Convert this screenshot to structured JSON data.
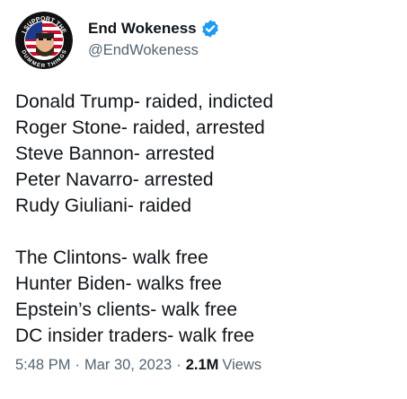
{
  "author": {
    "display_name": "End Wokeness",
    "handle": "@EndWokeness",
    "avatar_text_top": "I SUPPORT THE",
    "avatar_text_bottom": "DUMMER THINGS"
  },
  "tweet": {
    "lines": [
      "Donald Trump- raided, indicted",
      "Roger Stone- raided, arrested",
      "Steve Bannon- arrested",
      "Peter Navarro- arrested",
      "Rudy Giuliani- raided",
      "",
      "The Clintons- walk free",
      "Hunter Biden- walks free",
      "Epstein’s clients- walk free",
      "DC insider traders- walk free"
    ]
  },
  "meta": {
    "time": "5:48 PM",
    "separator": "·",
    "date": "Mar 30, 2023",
    "views_count": "2.1M",
    "views_label": "Views"
  },
  "colors": {
    "verified_badge": "#1d9bf0",
    "text_primary": "#0f1419",
    "text_secondary": "#536471"
  },
  "icons": {
    "verified": "verified-badge-icon"
  }
}
